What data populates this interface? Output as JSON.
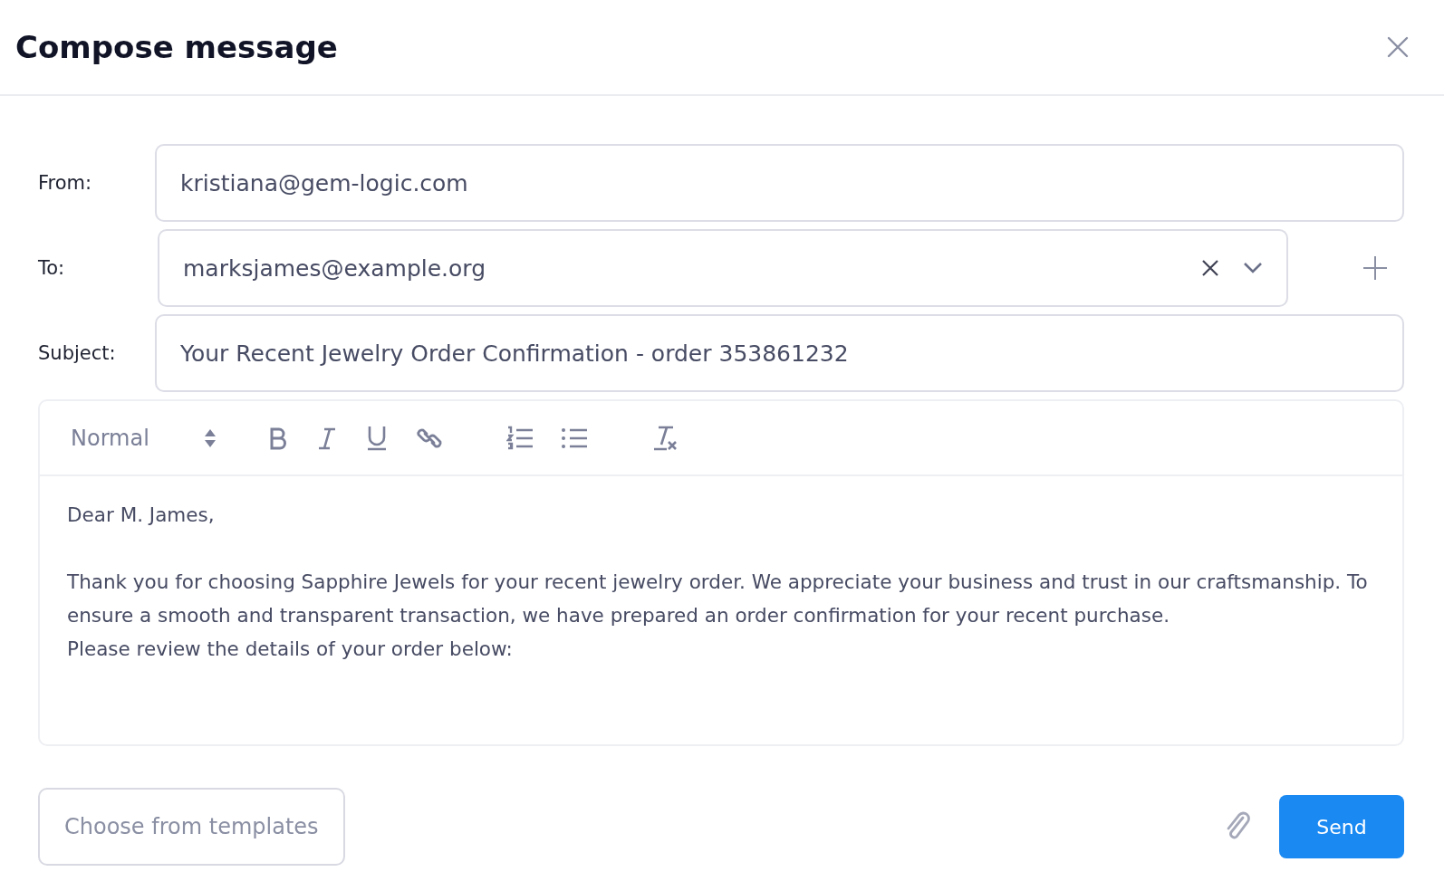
{
  "window": {
    "title": "Compose message"
  },
  "from": {
    "label": "From:",
    "value": "kristiana@gem-logic.com"
  },
  "to": {
    "label": "To:",
    "value": "marksjames@example.org"
  },
  "subject": {
    "label": "Subject:",
    "value": "Your Recent Jewelry Order Confirmation - order 353861232"
  },
  "editor": {
    "format": "Normal",
    "body": [
      [
        "Dear M. James,"
      ],
      [
        "Thank you for choosing Sapphire Jewels for your recent jewelry order. We appreciate your business and trust in our craftsmanship. To ensure a smooth and transparent transaction, we have prepared an order confirmation for your recent purchase.",
        "Please review the details of your order below:"
      ]
    ]
  },
  "footer": {
    "templates": "Choose from templates",
    "send": "Send"
  }
}
